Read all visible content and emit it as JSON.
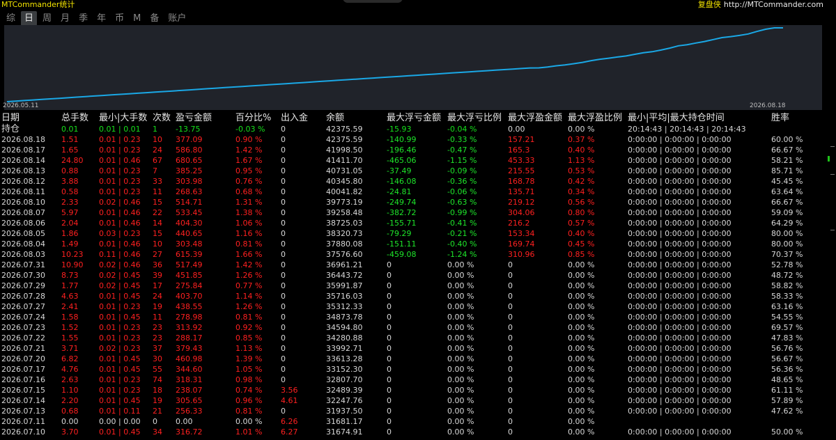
{
  "app": {
    "title": "MTCommander统计",
    "brand": "复盘侠",
    "url": "http://MTCommander.com"
  },
  "tabs": [
    "综",
    "日",
    "周",
    "月",
    "季",
    "年",
    "币",
    "M",
    "备",
    "账户"
  ],
  "chart": {
    "start_date": "2026.05.11",
    "end_date": "2026.08.18",
    "line_color": "#1aa8e6"
  },
  "headers": {
    "date": "日期",
    "total_lots": "总手数",
    "min_max_lots": "最小|大手数",
    "count": "次数",
    "pnl": "盈亏金额",
    "pct": "百分比%",
    "deposit": "出入金",
    "balance": "余额",
    "max_float_loss": "最大浮亏金额",
    "max_float_loss_pct": "最大浮亏比例",
    "max_float_profit": "最大浮盈金额",
    "max_float_profit_pct": "最大浮盈比例",
    "hold_time": "最小|平均|最大持仓时间",
    "winrate": "胜率"
  },
  "position": {
    "label": "持仓",
    "total_lots": "0.01",
    "min_max_lots": "0.01 | 0.01",
    "count": "1",
    "pnl": "-13.75",
    "pct": "-0.03 %",
    "deposit": "0",
    "balance": "42375.59",
    "max_float_loss": "-15.93",
    "max_float_loss_pct": "-0.04 %",
    "max_float_profit": "0.00",
    "max_float_profit_pct": "0.00 %",
    "hold_time": "20:14:43 | 20:14:43 | 20:14:43",
    "winrate": ""
  },
  "rows": [
    {
      "date": "2026.08.18",
      "total_lots": "1.51",
      "min_max_lots": "0.01 | 0.23",
      "count": "10",
      "pnl": "377.09",
      "pct": "0.90 %",
      "deposit": "0",
      "balance": "42375.59",
      "max_float_loss": "-140.99",
      "max_float_loss_pct": "-0.33 %",
      "max_float_profit": "157.21",
      "max_float_profit_pct": "0.37 %",
      "hold_time": "0:00:00 | 0:00:00 | 0:00:00",
      "winrate": "60.00 %"
    },
    {
      "date": "2026.08.17",
      "total_lots": "1.65",
      "min_max_lots": "0.01 | 0.23",
      "count": "24",
      "pnl": "586.80",
      "pct": "1.42 %",
      "deposit": "0",
      "balance": "41998.50",
      "max_float_loss": "-196.46",
      "max_float_loss_pct": "-0.47 %",
      "max_float_profit": "165.3",
      "max_float_profit_pct": "0.40 %",
      "hold_time": "0:00:00 | 0:00:00 | 0:00:00",
      "winrate": "66.67 %"
    },
    {
      "date": "2026.08.14",
      "total_lots": "24.80",
      "min_max_lots": "0.01 | 0.46",
      "count": "67",
      "pnl": "680.65",
      "pct": "1.67 %",
      "deposit": "0",
      "balance": "41411.70",
      "max_float_loss": "-465.06",
      "max_float_loss_pct": "-1.15 %",
      "max_float_profit": "453.33",
      "max_float_profit_pct": "1.13 %",
      "hold_time": "0:00:00 | 0:00:00 | 0:00:00",
      "winrate": "58.21 %"
    },
    {
      "date": "2026.08.13",
      "total_lots": "0.88",
      "min_max_lots": "0.01 | 0.23",
      "count": "7",
      "pnl": "385.25",
      "pct": "0.95 %",
      "deposit": "0",
      "balance": "40731.05",
      "max_float_loss": "-37.49",
      "max_float_loss_pct": "-0.09 %",
      "max_float_profit": "215.55",
      "max_float_profit_pct": "0.53 %",
      "hold_time": "0:00:00 | 0:00:00 | 0:00:00",
      "winrate": "85.71 %"
    },
    {
      "date": "2026.08.12",
      "total_lots": "3.88",
      "min_max_lots": "0.01 | 0.23",
      "count": "33",
      "pnl": "303.98",
      "pct": "0.76 %",
      "deposit": "0",
      "balance": "40345.80",
      "max_float_loss": "-146.08",
      "max_float_loss_pct": "-0.36 %",
      "max_float_profit": "168.78",
      "max_float_profit_pct": "0.42 %",
      "hold_time": "0:00:00 | 0:00:00 | 0:00:00",
      "winrate": "45.45 %"
    },
    {
      "date": "2026.08.11",
      "total_lots": "0.58",
      "min_max_lots": "0.01 | 0.23",
      "count": "11",
      "pnl": "268.63",
      "pct": "0.68 %",
      "deposit": "0",
      "balance": "40041.82",
      "max_float_loss": "-24.81",
      "max_float_loss_pct": "-0.06 %",
      "max_float_profit": "135.71",
      "max_float_profit_pct": "0.34 %",
      "hold_time": "0:00:00 | 0:00:00 | 0:00:00",
      "winrate": "63.64 %"
    },
    {
      "date": "2026.08.10",
      "total_lots": "2.33",
      "min_max_lots": "0.02 | 0.46",
      "count": "15",
      "pnl": "514.71",
      "pct": "1.31 %",
      "deposit": "0",
      "balance": "39773.19",
      "max_float_loss": "-249.74",
      "max_float_loss_pct": "-0.63 %",
      "max_float_profit": "219.12",
      "max_float_profit_pct": "0.56 %",
      "hold_time": "0:00:00 | 0:00:00 | 0:00:00",
      "winrate": "66.67 %"
    },
    {
      "date": "2026.08.07",
      "total_lots": "5.97",
      "min_max_lots": "0.01 | 0.46",
      "count": "22",
      "pnl": "533.45",
      "pct": "1.38 %",
      "deposit": "0",
      "balance": "39258.48",
      "max_float_loss": "-382.72",
      "max_float_loss_pct": "-0.99 %",
      "max_float_profit": "304.06",
      "max_float_profit_pct": "0.80 %",
      "hold_time": "0:00:00 | 0:00:00 | 0:00:00",
      "winrate": "59.09 %"
    },
    {
      "date": "2026.08.06",
      "total_lots": "2.04",
      "min_max_lots": "0.01 | 0.46",
      "count": "14",
      "pnl": "404.30",
      "pct": "1.06 %",
      "deposit": "0",
      "balance": "38725.03",
      "max_float_loss": "-155.71",
      "max_float_loss_pct": "-0.41 %",
      "max_float_profit": "216.2",
      "max_float_profit_pct": "0.57 %",
      "hold_time": "0:00:00 | 0:00:00 | 0:00:00",
      "winrate": "64.29 %"
    },
    {
      "date": "2026.08.05",
      "total_lots": "1.86",
      "min_max_lots": "0.03 | 0.23",
      "count": "15",
      "pnl": "440.65",
      "pct": "1.16 %",
      "deposit": "0",
      "balance": "38320.73",
      "max_float_loss": "-79.29",
      "max_float_loss_pct": "-0.21 %",
      "max_float_profit": "153.34",
      "max_float_profit_pct": "0.40 %",
      "hold_time": "0:00:00 | 0:00:00 | 0:00:00",
      "winrate": "80.00 %"
    },
    {
      "date": "2026.08.04",
      "total_lots": "1.49",
      "min_max_lots": "0.01 | 0.46",
      "count": "10",
      "pnl": "303.48",
      "pct": "0.81 %",
      "deposit": "0",
      "balance": "37880.08",
      "max_float_loss": "-151.11",
      "max_float_loss_pct": "-0.40 %",
      "max_float_profit": "169.74",
      "max_float_profit_pct": "0.45 %",
      "hold_time": "0:00:00 | 0:00:00 | 0:00:00",
      "winrate": "80.00 %"
    },
    {
      "date": "2026.08.03",
      "total_lots": "10.23",
      "min_max_lots": "0.11 | 0.46",
      "count": "27",
      "pnl": "615.39",
      "pct": "1.66 %",
      "deposit": "0",
      "balance": "37576.60",
      "max_float_loss": "-459.08",
      "max_float_loss_pct": "-1.24 %",
      "max_float_profit": "310.96",
      "max_float_profit_pct": "0.85 %",
      "hold_time": "0:00:00 | 0:00:00 | 0:00:00",
      "winrate": "70.37 %"
    },
    {
      "date": "2026.07.31",
      "total_lots": "10.90",
      "min_max_lots": "0.02 | 0.46",
      "count": "36",
      "pnl": "517.49",
      "pct": "1.42 %",
      "deposit": "0",
      "balance": "36961.21",
      "max_float_loss": "0",
      "max_float_loss_pct": "0.00 %",
      "max_float_profit": "0",
      "max_float_profit_pct": "0.00 %",
      "hold_time": "0:00:00 | 0:00:00 | 0:00:00",
      "winrate": "52.78 %"
    },
    {
      "date": "2026.07.30",
      "total_lots": "8.73",
      "min_max_lots": "0.02 | 0.45",
      "count": "39",
      "pnl": "451.85",
      "pct": "1.26 %",
      "deposit": "0",
      "balance": "36443.72",
      "max_float_loss": "0",
      "max_float_loss_pct": "0.00 %",
      "max_float_profit": "0",
      "max_float_profit_pct": "0.00 %",
      "hold_time": "0:00:00 | 0:00:00 | 0:00:00",
      "winrate": "48.72 %"
    },
    {
      "date": "2026.07.29",
      "total_lots": "1.77",
      "min_max_lots": "0.02 | 0.45",
      "count": "17",
      "pnl": "275.84",
      "pct": "0.77 %",
      "deposit": "0",
      "balance": "35991.87",
      "max_float_loss": "0",
      "max_float_loss_pct": "0.00 %",
      "max_float_profit": "0",
      "max_float_profit_pct": "0.00 %",
      "hold_time": "0:00:00 | 0:00:00 | 0:00:00",
      "winrate": "58.82 %"
    },
    {
      "date": "2026.07.28",
      "total_lots": "4.63",
      "min_max_lots": "0.01 | 0.45",
      "count": "24",
      "pnl": "403.70",
      "pct": "1.14 %",
      "deposit": "0",
      "balance": "35716.03",
      "max_float_loss": "0",
      "max_float_loss_pct": "0.00 %",
      "max_float_profit": "0",
      "max_float_profit_pct": "0.00 %",
      "hold_time": "0:00:00 | 0:00:00 | 0:00:00",
      "winrate": "58.33 %"
    },
    {
      "date": "2026.07.27",
      "total_lots": "2.41",
      "min_max_lots": "0.01 | 0.23",
      "count": "19",
      "pnl": "438.55",
      "pct": "1.26 %",
      "deposit": "0",
      "balance": "35312.33",
      "max_float_loss": "0",
      "max_float_loss_pct": "0.00 %",
      "max_float_profit": "0",
      "max_float_profit_pct": "0.00 %",
      "hold_time": "0:00:00 | 0:00:00 | 0:00:00",
      "winrate": "63.16 %"
    },
    {
      "date": "2026.07.24",
      "total_lots": "1.58",
      "min_max_lots": "0.01 | 0.45",
      "count": "11",
      "pnl": "278.98",
      "pct": "0.81 %",
      "deposit": "0",
      "balance": "34873.78",
      "max_float_loss": "0",
      "max_float_loss_pct": "0.00 %",
      "max_float_profit": "0",
      "max_float_profit_pct": "0.00 %",
      "hold_time": "0:00:00 | 0:00:00 | 0:00:00",
      "winrate": "54.55 %"
    },
    {
      "date": "2026.07.23",
      "total_lots": "1.52",
      "min_max_lots": "0.01 | 0.23",
      "count": "23",
      "pnl": "313.92",
      "pct": "0.92 %",
      "deposit": "0",
      "balance": "34594.80",
      "max_float_loss": "0",
      "max_float_loss_pct": "0.00 %",
      "max_float_profit": "0",
      "max_float_profit_pct": "0.00 %",
      "hold_time": "0:00:00 | 0:00:00 | 0:00:00",
      "winrate": "69.57 %"
    },
    {
      "date": "2026.07.22",
      "total_lots": "1.55",
      "min_max_lots": "0.01 | 0.23",
      "count": "23",
      "pnl": "288.17",
      "pct": "0.85 %",
      "deposit": "0",
      "balance": "34280.88",
      "max_float_loss": "0",
      "max_float_loss_pct": "0.00 %",
      "max_float_profit": "0",
      "max_float_profit_pct": "0.00 %",
      "hold_time": "0:00:00 | 0:00:00 | 0:00:00",
      "winrate": "47.83 %"
    },
    {
      "date": "2026.07.21",
      "total_lots": "3.71",
      "min_max_lots": "0.02 | 0.23",
      "count": "37",
      "pnl": "379.43",
      "pct": "1.13 %",
      "deposit": "0",
      "balance": "33992.71",
      "max_float_loss": "0",
      "max_float_loss_pct": "0.00 %",
      "max_float_profit": "0",
      "max_float_profit_pct": "0.00 %",
      "hold_time": "0:00:00 | 0:00:00 | 0:00:00",
      "winrate": "56.76 %"
    },
    {
      "date": "2026.07.20",
      "total_lots": "6.82",
      "min_max_lots": "0.01 | 0.45",
      "count": "30",
      "pnl": "460.98",
      "pct": "1.39 %",
      "deposit": "0",
      "balance": "33613.28",
      "max_float_loss": "0",
      "max_float_loss_pct": "0.00 %",
      "max_float_profit": "0",
      "max_float_profit_pct": "0.00 %",
      "hold_time": "0:00:00 | 0:00:00 | 0:00:00",
      "winrate": "56.67 %"
    },
    {
      "date": "2026.07.17",
      "total_lots": "4.76",
      "min_max_lots": "0.01 | 0.45",
      "count": "55",
      "pnl": "344.60",
      "pct": "1.05 %",
      "deposit": "0",
      "balance": "33152.30",
      "max_float_loss": "0",
      "max_float_loss_pct": "0.00 %",
      "max_float_profit": "0",
      "max_float_profit_pct": "0.00 %",
      "hold_time": "0:00:00 | 0:00:00 | 0:00:00",
      "winrate": "56.36 %"
    },
    {
      "date": "2026.07.16",
      "total_lots": "2.63",
      "min_max_lots": "0.01 | 0.23",
      "count": "74",
      "pnl": "318.31",
      "pct": "0.98 %",
      "deposit": "0",
      "balance": "32807.70",
      "max_float_loss": "0",
      "max_float_loss_pct": "0.00 %",
      "max_float_profit": "0",
      "max_float_profit_pct": "0.00 %",
      "hold_time": "0:00:00 | 0:00:00 | 0:00:00",
      "winrate": "48.65 %"
    },
    {
      "date": "2026.07.15",
      "total_lots": "1.10",
      "min_max_lots": "0.01 | 0.23",
      "count": "18",
      "pnl": "238.07",
      "pct": "0.74 %",
      "deposit": "3.56",
      "balance": "32489.39",
      "max_float_loss": "0",
      "max_float_loss_pct": "0.00 %",
      "max_float_profit": "0",
      "max_float_profit_pct": "0.00 %",
      "hold_time": "0:00:00 | 0:00:00 | 0:00:00",
      "winrate": "61.11 %"
    },
    {
      "date": "2026.07.14",
      "total_lots": "2.20",
      "min_max_lots": "0.01 | 0.45",
      "count": "19",
      "pnl": "305.65",
      "pct": "0.96 %",
      "deposit": "4.61",
      "balance": "32247.76",
      "max_float_loss": "0",
      "max_float_loss_pct": "0.00 %",
      "max_float_profit": "0",
      "max_float_profit_pct": "0.00 %",
      "hold_time": "0:00:00 | 0:00:00 | 0:00:00",
      "winrate": "57.89 %"
    },
    {
      "date": "2026.07.13",
      "total_lots": "0.68",
      "min_max_lots": "0.01 | 0.11",
      "count": "21",
      "pnl": "256.33",
      "pct": "0.81 %",
      "deposit": "0",
      "balance": "31937.50",
      "max_float_loss": "0",
      "max_float_loss_pct": "0.00 %",
      "max_float_profit": "0",
      "max_float_profit_pct": "0.00 %",
      "hold_time": "0:00:00 | 0:00:00 | 0:00:00",
      "winrate": "47.62 %"
    },
    {
      "date": "2026.07.11",
      "total_lots": "0.00",
      "min_max_lots": "0.00 | 0.00",
      "count": "0",
      "pnl": "0.00",
      "pct": "0.00 %",
      "deposit": "6.26",
      "balance": "31681.17",
      "max_float_loss": "0",
      "max_float_loss_pct": "0.00 %",
      "max_float_profit": "0",
      "max_float_profit_pct": "0.00 %",
      "hold_time": "",
      "winrate": ""
    },
    {
      "date": "2026.07.10",
      "total_lots": "3.70",
      "min_max_lots": "0.01 | 0.45",
      "count": "34",
      "pnl": "316.72",
      "pct": "1.01 %",
      "deposit": "6.27",
      "balance": "31674.91",
      "max_float_loss": "0",
      "max_float_loss_pct": "0.00 %",
      "max_float_profit": "0",
      "max_float_profit_pct": "0.00 %",
      "hold_time": "0:00:00 | 0:00:00 | 0:00:00",
      "winrate": "50.00 %"
    }
  ]
}
